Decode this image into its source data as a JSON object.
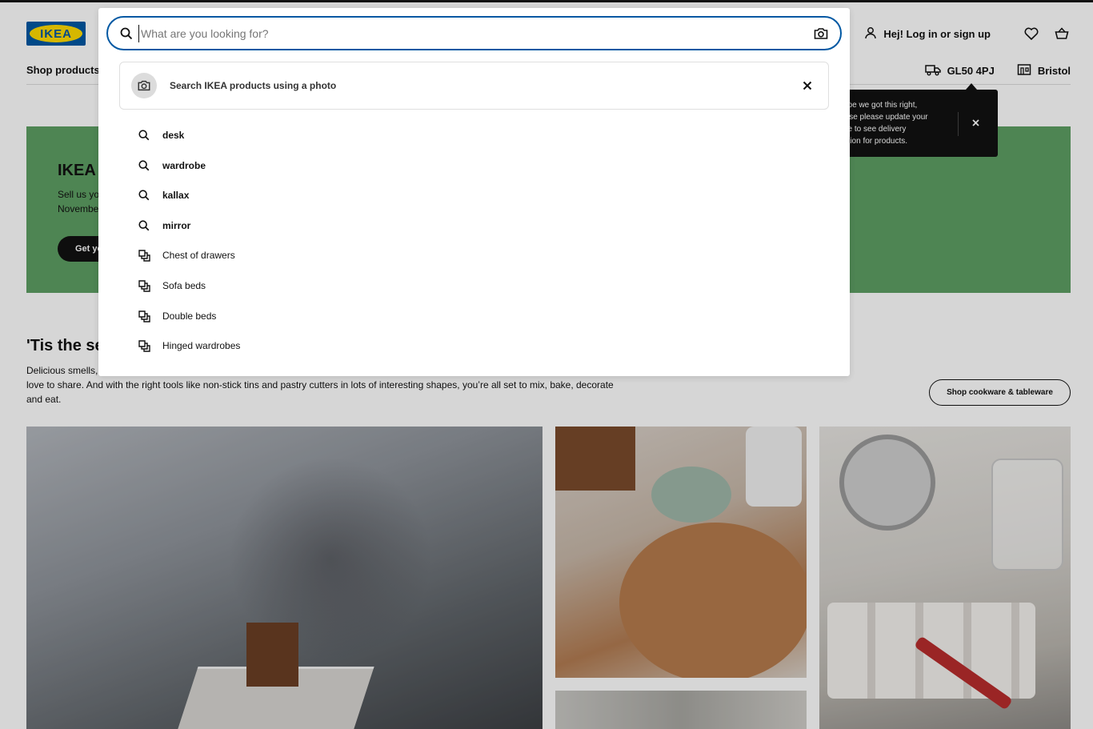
{
  "brand": {
    "logo_text": "IKEA",
    "primary": "#0058a3",
    "yellow": "#ffdb00"
  },
  "header": {
    "login_label": "Hej! Log in or sign up",
    "nav_shop": "Shop products",
    "postcode": "GL50 4PJ",
    "store": "Bristol",
    "icons": [
      "user-icon",
      "heart-icon",
      "basket-icon",
      "truck-icon",
      "store-icon"
    ]
  },
  "tooltip": {
    "text": "ope we got this right,\nvise please update your\nde to see delivery\nation for products."
  },
  "banner": {
    "title": "IKEA",
    "body": "Sell us yo\nNovembe",
    "button": "Get yo",
    "color": "#5e9f63"
  },
  "section": {
    "title": "'Tis the se",
    "body": "Delicious smells, love to share. And with the right tools like non-stick tins and pastry cutters in lots of interesting shapes, you're all set to mix, bake, decorate and eat.",
    "body_line1": "Delicious smells,",
    "body_line2": "love to share. And with the right tools like non-stick tins and pastry cutters in lots of interesting shapes, you’re all set to mix, bake, decorate",
    "body_line3": "and eat.",
    "button": "Shop cookware & tableware"
  },
  "search": {
    "placeholder": "What are you looking for?",
    "value": "",
    "photo_search_label": "Search IKEA products using a photo"
  },
  "suggestions": [
    {
      "label": "desk",
      "kind": "query"
    },
    {
      "label": "wardrobe",
      "kind": "query"
    },
    {
      "label": "kallax",
      "kind": "query"
    },
    {
      "label": "mirror",
      "kind": "query"
    },
    {
      "label": "Chest of drawers",
      "kind": "category"
    },
    {
      "label": "Sofa beds",
      "kind": "category"
    },
    {
      "label": "Double beds",
      "kind": "category"
    },
    {
      "label": "Hinged wardrobes",
      "kind": "category"
    }
  ]
}
